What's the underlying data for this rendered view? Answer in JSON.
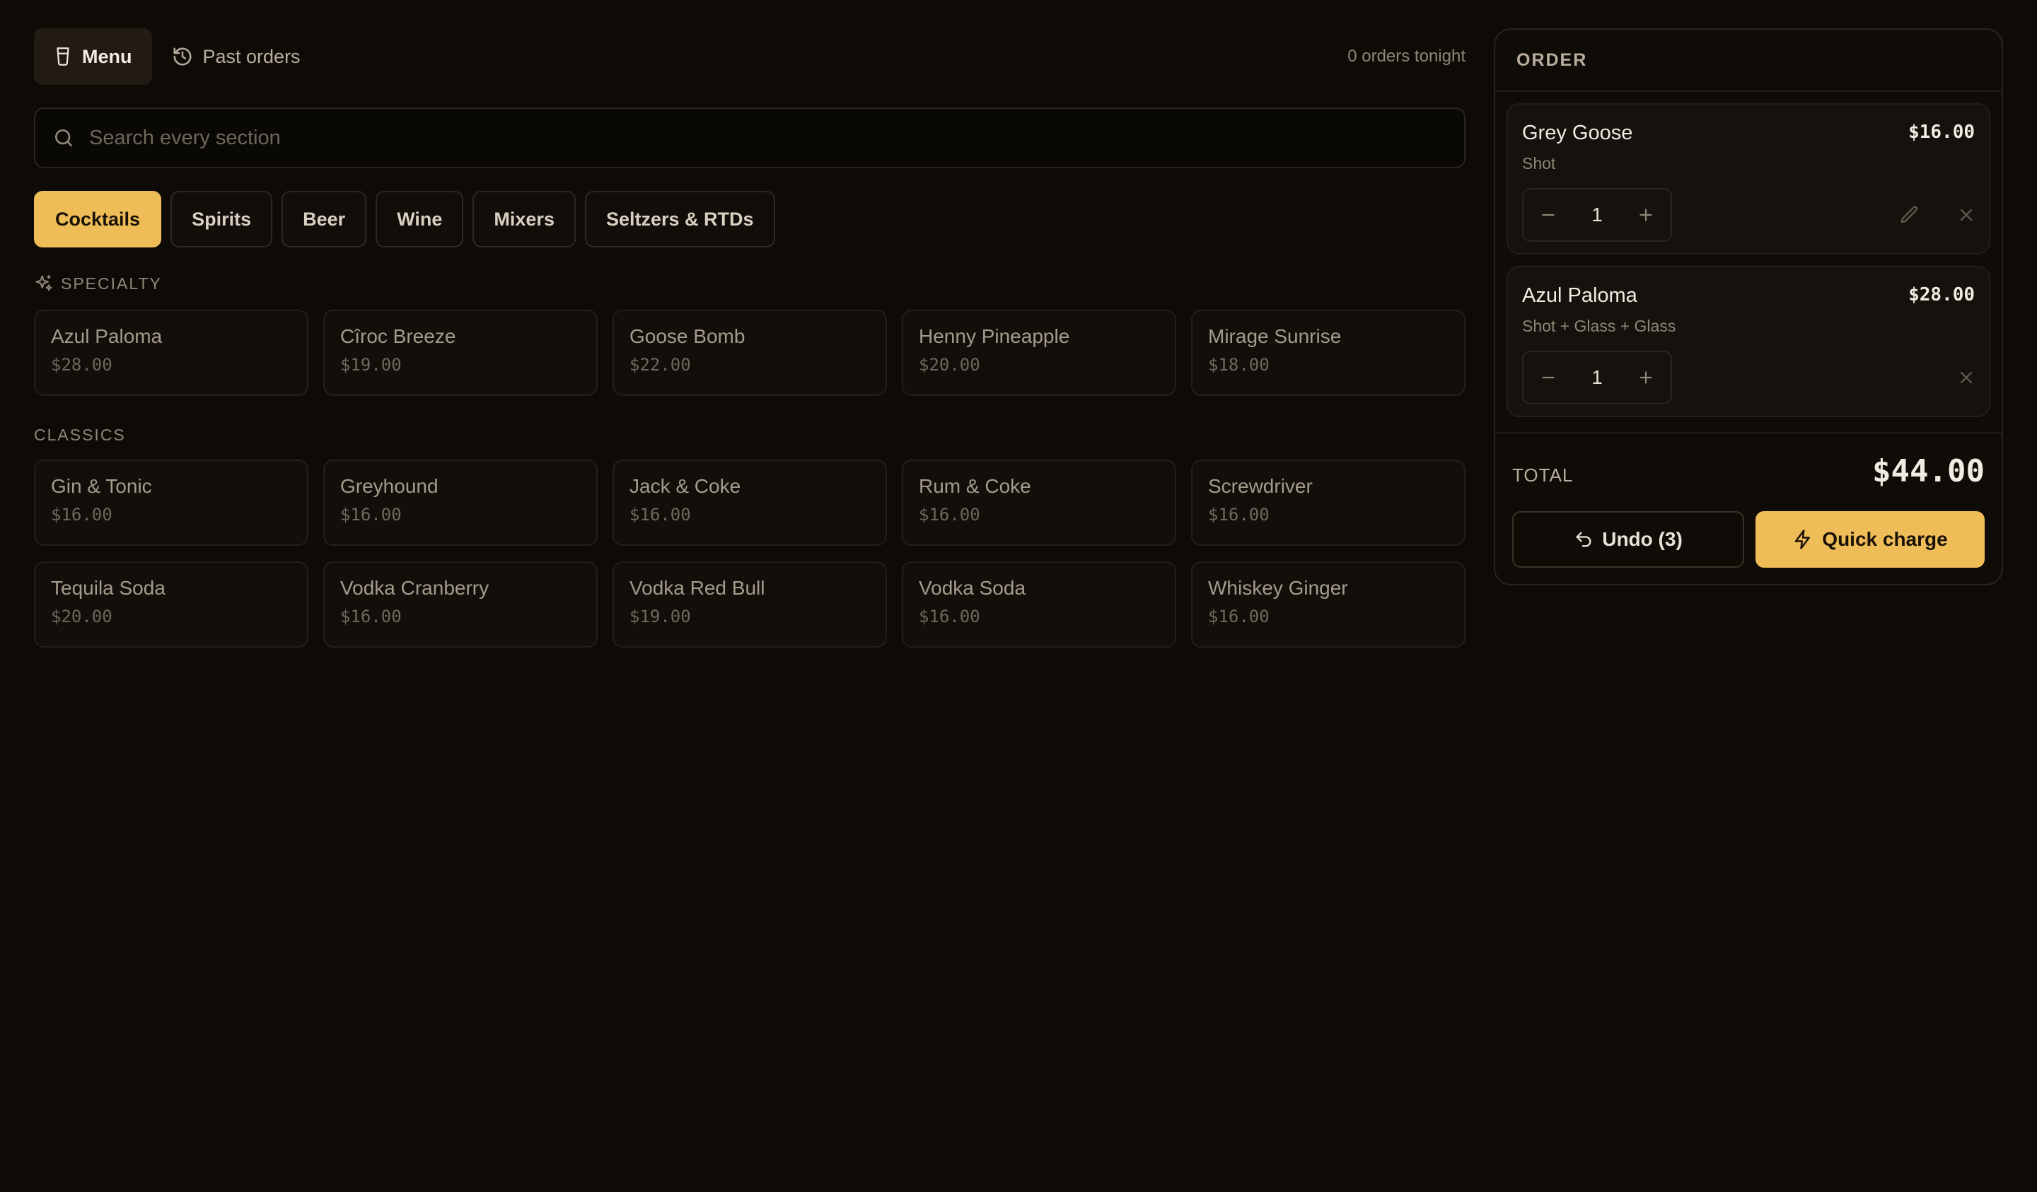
{
  "nav": {
    "menu_label": "Menu",
    "menu_icon": "glass-icon",
    "past_orders_label": "Past orders",
    "past_orders_icon": "history-icon",
    "orders_count": "0 orders tonight"
  },
  "search": {
    "placeholder": "Search every section",
    "value": ""
  },
  "tabs": [
    {
      "label": "Cocktails",
      "active": true
    },
    {
      "label": "Spirits",
      "active": false
    },
    {
      "label": "Beer",
      "active": false
    },
    {
      "label": "Wine",
      "active": false
    },
    {
      "label": "Mixers",
      "active": false
    },
    {
      "label": "Seltzers & RTDs",
      "active": false
    }
  ],
  "sections": {
    "specialty": {
      "title": "SPECIALTY",
      "icon": "sparkles-icon",
      "items": [
        {
          "name": "Azul Paloma",
          "price": "$28.00"
        },
        {
          "name": "Cîroc Breeze",
          "price": "$19.00"
        },
        {
          "name": "Goose Bomb",
          "price": "$22.00"
        },
        {
          "name": "Henny Pineapple",
          "price": "$20.00"
        },
        {
          "name": "Mirage Sunrise",
          "price": "$18.00"
        }
      ]
    },
    "classics": {
      "title": "CLASSICS",
      "items": [
        {
          "name": "Gin & Tonic",
          "price": "$16.00"
        },
        {
          "name": "Greyhound",
          "price": "$16.00"
        },
        {
          "name": "Jack & Coke",
          "price": "$16.00"
        },
        {
          "name": "Rum & Coke",
          "price": "$16.00"
        },
        {
          "name": "Screwdriver",
          "price": "$16.00"
        },
        {
          "name": "Tequila Soda",
          "price": "$20.00"
        },
        {
          "name": "Vodka Cranberry",
          "price": "$16.00"
        },
        {
          "name": "Vodka Red Bull",
          "price": "$19.00"
        },
        {
          "name": "Vodka Soda",
          "price": "$16.00"
        },
        {
          "name": "Whiskey Ginger",
          "price": "$16.00"
        }
      ]
    }
  },
  "order": {
    "title": "ORDER",
    "lines": [
      {
        "name": "Grey Goose",
        "modifiers": "Shot",
        "price": "$16.00",
        "qty": "1",
        "editable": true
      },
      {
        "name": "Azul Paloma",
        "modifiers": "Shot + Glass + Glass",
        "price": "$28.00",
        "qty": "1",
        "editable": false
      }
    ],
    "total_label": "TOTAL",
    "total_value": "$44.00",
    "undo_label": "Undo (3)",
    "charge_label": "Quick charge"
  },
  "colors": {
    "background": "#0e0b07",
    "accent": "#efbd58",
    "text_primary": "#f1ebe1",
    "text_muted": "#8f8678"
  }
}
